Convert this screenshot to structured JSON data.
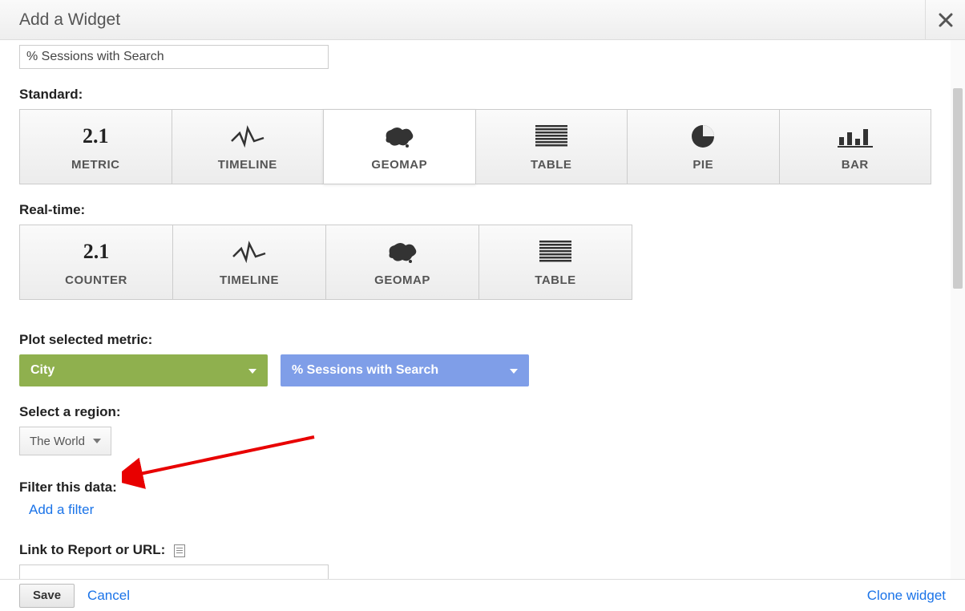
{
  "dialog": {
    "title": "Add a Widget"
  },
  "titleField": {
    "value": "% Sessions with Search"
  },
  "sections": {
    "standard": "Standard:",
    "realtime": "Real-time:",
    "plot": "Plot selected metric:",
    "region": "Select a region:",
    "filter": "Filter this data:",
    "linkReport": "Link to Report or URL:"
  },
  "widgets": {
    "standard": [
      {
        "key": "metric",
        "label": "METRIC",
        "icon": "num"
      },
      {
        "key": "timeline",
        "label": "TIMELINE",
        "icon": "timeline"
      },
      {
        "key": "geomap",
        "label": "GEOMAP",
        "icon": "geomap",
        "selected": true
      },
      {
        "key": "table",
        "label": "TABLE",
        "icon": "table"
      },
      {
        "key": "pie",
        "label": "PIE",
        "icon": "pie"
      },
      {
        "key": "bar",
        "label": "BAR",
        "icon": "bar"
      }
    ],
    "realtime": [
      {
        "key": "counter",
        "label": "COUNTER",
        "icon": "num"
      },
      {
        "key": "timeline",
        "label": "TIMELINE",
        "icon": "timeline"
      },
      {
        "key": "geomap",
        "label": "GEOMAP",
        "icon": "geomap"
      },
      {
        "key": "table",
        "label": "TABLE",
        "icon": "table"
      }
    ]
  },
  "iconNum": "2.1",
  "plot": {
    "dimension": "City",
    "metric": "% Sessions with Search"
  },
  "regionSelect": {
    "value": "The World"
  },
  "filterLink": "Add a filter",
  "linkReportInput": {
    "value": ""
  },
  "footer": {
    "save": "Save",
    "cancel": "Cancel",
    "clone": "Clone widget"
  }
}
